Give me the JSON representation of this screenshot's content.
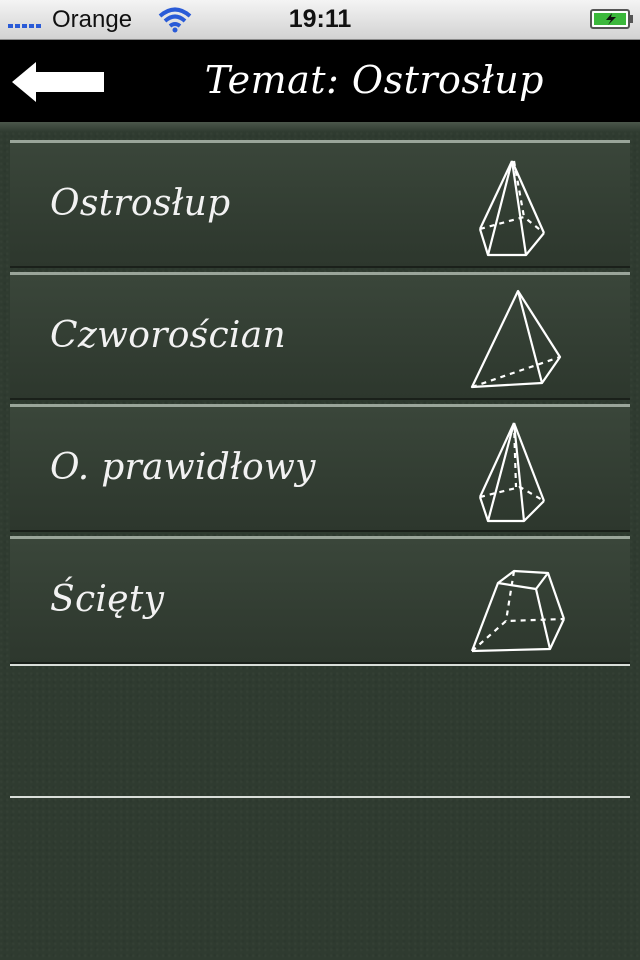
{
  "status_bar": {
    "carrier": "Orange",
    "time": "19:11"
  },
  "nav": {
    "back_icon": "back-arrow-icon",
    "title": "Temat: Ostrosłup"
  },
  "menu": {
    "items": [
      {
        "label": "Ostrosłup",
        "icon": "pentagonal-pyramid-icon"
      },
      {
        "label": "Czworościan",
        "icon": "tetrahedron-icon"
      },
      {
        "label": "O. prawidłowy",
        "icon": "regular-pyramid-icon"
      },
      {
        "label": "Ścięty",
        "icon": "frustum-icon"
      }
    ]
  },
  "colors": {
    "background": "#2f3b30",
    "nav_background": "#000000",
    "text": "#f2f2f2"
  }
}
